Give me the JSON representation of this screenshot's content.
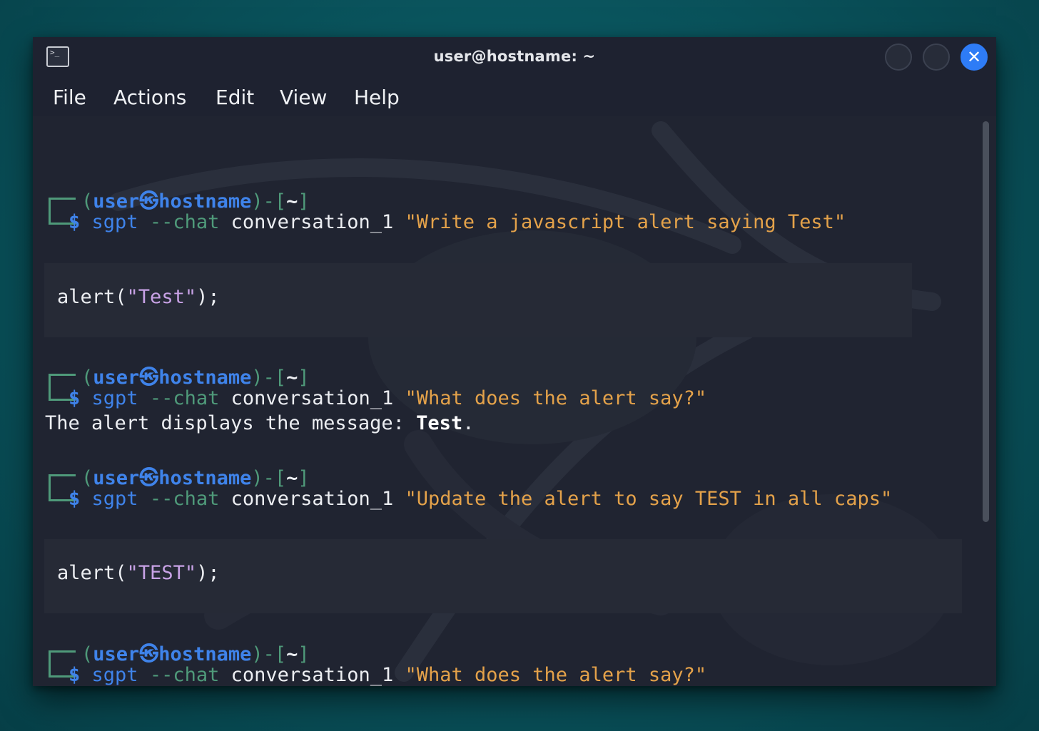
{
  "window": {
    "title": "user@hostname: ~",
    "terminal_icon_glyph": ">_"
  },
  "menu": [
    "File",
    "Actions",
    "Edit",
    "View",
    "Help"
  ],
  "prompt": {
    "open": "(",
    "user": "user",
    "at_symbol": "㉿",
    "host": "hostname",
    "close": ")-[",
    "dir": "~",
    "end": "]",
    "dollar": "$"
  },
  "commands": [
    {
      "program": "sgpt",
      "flag": "--chat",
      "session": "conversation_1",
      "prompt": "\"Write a javascript alert saying Test\""
    },
    {
      "program": "sgpt",
      "flag": "--chat",
      "session": "conversation_1",
      "prompt": "\"What does the alert say?\""
    },
    {
      "program": "sgpt",
      "flag": "--chat",
      "session": "conversation_1",
      "prompt": "\"Update the alert to say TEST in all caps\""
    },
    {
      "program": "sgpt",
      "flag": "--chat",
      "session": "conversation_1",
      "prompt": "\"What does the alert say?\""
    }
  ],
  "outputs": {
    "code1": {
      "fn": "alert(",
      "arg": "\"Test\"",
      "end": ");"
    },
    "answer": {
      "text": "The alert displays the message: ",
      "bold": "Test",
      "end": "."
    },
    "code2": {
      "fn": "alert(",
      "arg": "\"TEST\"",
      "end": ");"
    }
  },
  "colors": {
    "window_bg": "#202431",
    "prompt_blue": "#3f83ea",
    "prompt_green": "#4f9a7a",
    "string_orange": "#e4a24a",
    "close_button": "#2e7cf6"
  }
}
